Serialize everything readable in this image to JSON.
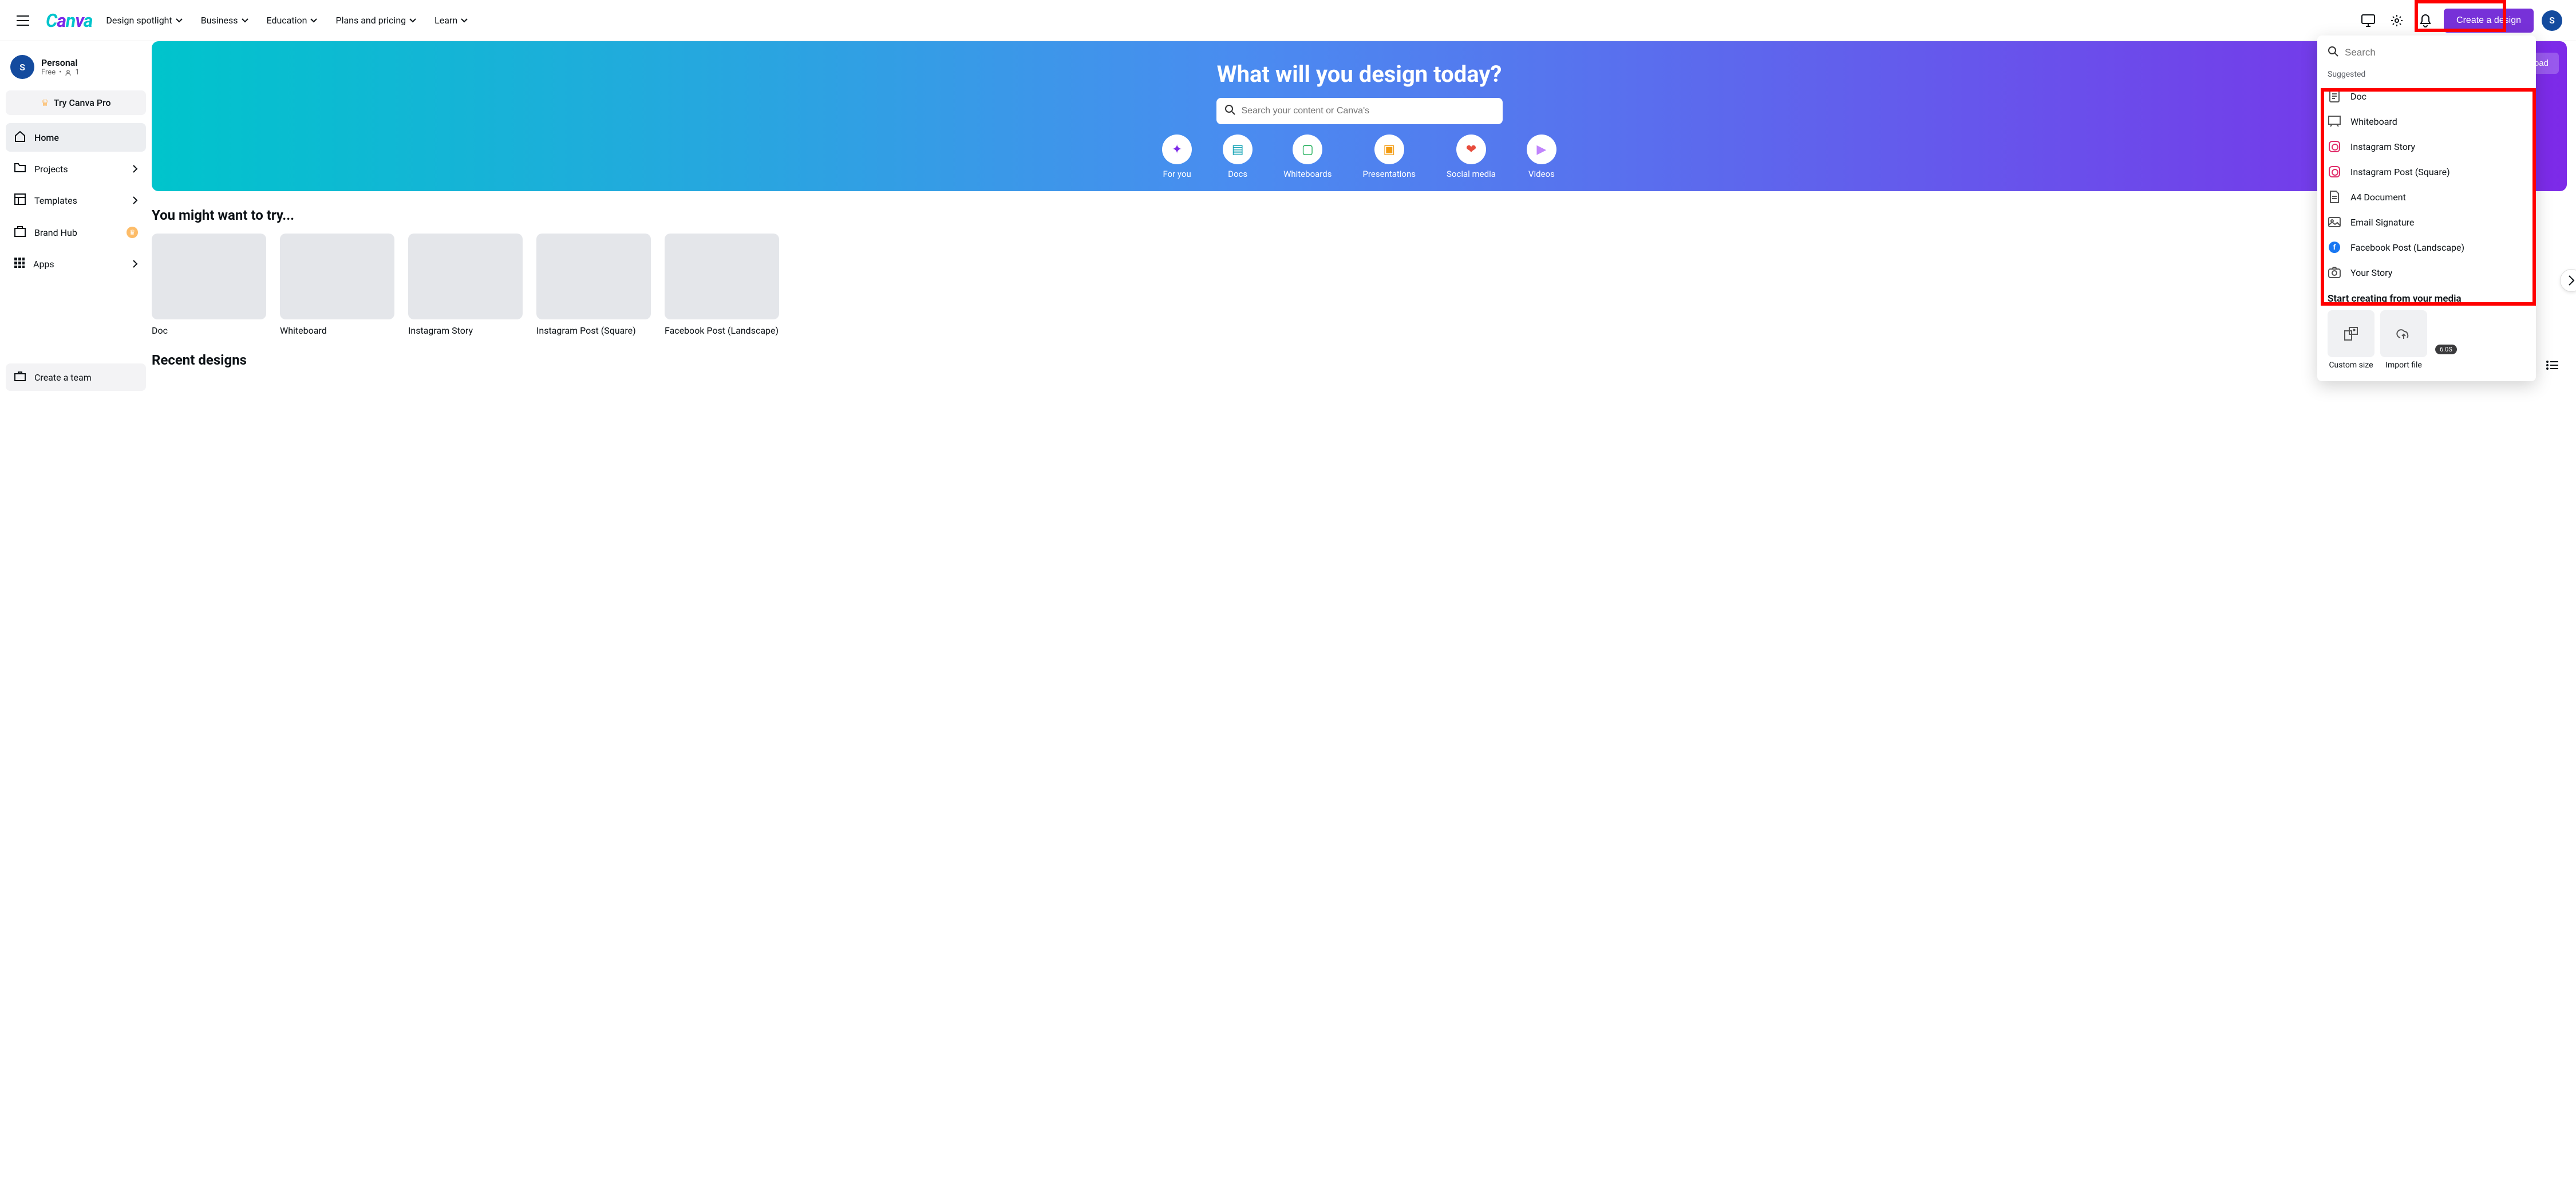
{
  "nav": {
    "items": [
      "Design spotlight",
      "Business",
      "Education",
      "Plans and pricing",
      "Learn"
    ],
    "create_label": "Create a design",
    "avatar_letter": "S"
  },
  "sidebar": {
    "account": {
      "name": "Personal",
      "plan": "Free",
      "members": "1"
    },
    "pro_label": "Try Canva Pro",
    "items": [
      "Home",
      "Projects",
      "Templates",
      "Brand Hub",
      "Apps"
    ],
    "create_team": "Create a team"
  },
  "hero": {
    "title": "What will you design today?",
    "search_placeholder": "Search your content or Canva's",
    "upload_label": "Upload",
    "categories": [
      "For you",
      "Docs",
      "Whiteboards",
      "Presentations",
      "Social media",
      "Videos"
    ]
  },
  "try": {
    "heading": "You might want to try...",
    "cards": [
      "Doc",
      "Whiteboard",
      "Instagram Story",
      "Instagram Post (Square)",
      "Facebook Post (Landscape)"
    ]
  },
  "recent": {
    "heading": "Recent designs"
  },
  "panel": {
    "search_placeholder": "Search",
    "suggested_label": "Suggested",
    "suggestions": [
      "Doc",
      "Whiteboard",
      "Instagram Story",
      "Instagram Post (Square)",
      "A4 Document",
      "Email Signature",
      "Facebook Post (Landscape)",
      "Your Story"
    ],
    "media_heading": "Start creating from your media",
    "custom_size": "Custom size",
    "import_file": "Import file",
    "badge": "6.0S"
  }
}
